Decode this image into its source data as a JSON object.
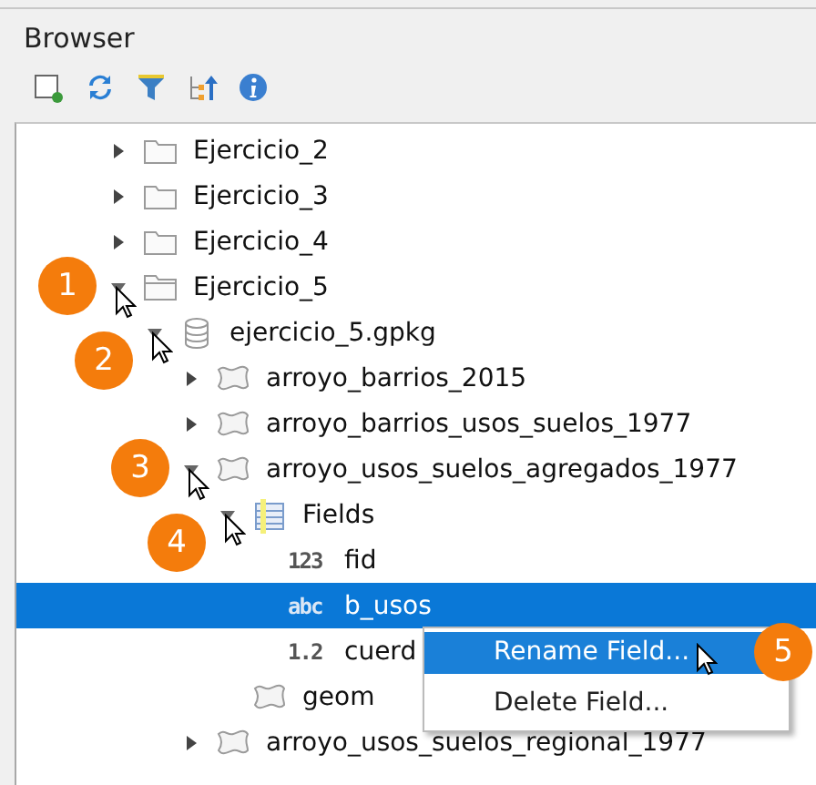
{
  "panel": {
    "title": "Browser"
  },
  "tree": [
    {
      "label": "Ejercicio_2",
      "kind": "folder",
      "expanded": false,
      "selected": false
    },
    {
      "label": "Ejercicio_3",
      "kind": "folder",
      "expanded": false,
      "selected": false
    },
    {
      "label": "Ejercicio_4",
      "kind": "folder",
      "expanded": false,
      "selected": false
    },
    {
      "label": "Ejercicio_5",
      "kind": "folder",
      "expanded": true,
      "selected": false,
      "badge": "1",
      "children": [
        {
          "label": "ejercicio_5.gpkg",
          "kind": "database",
          "expanded": true,
          "selected": false,
          "badge": "2",
          "children": [
            {
              "label": "arroyo_barrios_2015",
              "kind": "layer",
              "expanded": false,
              "selected": false
            },
            {
              "label": "arroyo_barrios_usos_suelos_1977",
              "kind": "layer",
              "expanded": false,
              "selected": false
            },
            {
              "label": "arroyo_usos_suelos_agregados_1977",
              "kind": "layer",
              "expanded": true,
              "selected": false,
              "badge": "3",
              "children": [
                {
                  "label": "Fields",
                  "kind": "fields",
                  "expanded": true,
                  "selected": false,
                  "badge": "4",
                  "children": [
                    {
                      "label": "fid",
                      "kind": "field",
                      "type_label": "123",
                      "selected": false
                    },
                    {
                      "label": "b_usos",
                      "kind": "field",
                      "type_label": "abc",
                      "selected": true
                    },
                    {
                      "label": "cuerd",
                      "kind": "field",
                      "type_label": "1.2",
                      "selected": false
                    }
                  ]
                },
                {
                  "label": "geom",
                  "kind": "geometry",
                  "selected": false
                }
              ]
            },
            {
              "label": "arroyo_usos_suelos_regional_1977",
              "kind": "layer",
              "expanded": false,
              "selected": false
            }
          ]
        }
      ]
    }
  ],
  "context_menu": {
    "items": [
      {
        "label": "Rename Field...",
        "selected": true,
        "badge": "5"
      },
      {
        "label": "Delete Field...",
        "selected": false
      }
    ]
  }
}
